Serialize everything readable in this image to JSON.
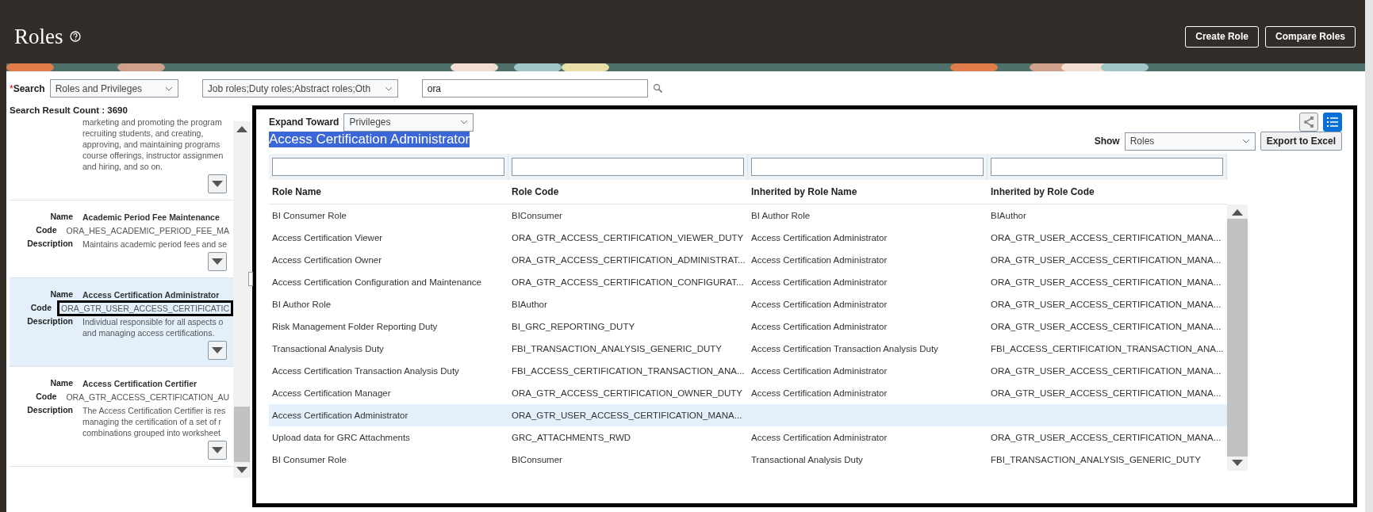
{
  "header": {
    "title": "Roles",
    "actions": [
      "Create Role",
      "Compare Roles"
    ]
  },
  "search": {
    "required_mark": "*",
    "label": "Search",
    "scope": "Roles and Privileges",
    "role_types": "Job roles;Duty roles;Abstract roles;Oth",
    "query": "ora"
  },
  "result_count": "Search Result Count : 3690",
  "results": [
    {
      "selected": false,
      "fields": [
        {
          "lines": [
            "marketing and promoting the program",
            "recruiting students, and creating,",
            "approving, and maintaining programs",
            "course offerings, instructor assignmen",
            "and hiring, and so on."
          ]
        }
      ]
    },
    {
      "selected": false,
      "fields": [
        {
          "label": "Name",
          "lines": [
            "Academic Period Fee Maintenance"
          ],
          "bold": true
        },
        {
          "label": "Code",
          "lines": [
            "ORA_HES_ACADEMIC_PERIOD_FEE_MA"
          ]
        },
        {
          "label": "Description",
          "lines": [
            "Maintains academic period fees and se"
          ]
        }
      ]
    },
    {
      "selected": true,
      "fields": [
        {
          "label": "Name",
          "lines": [
            "Access Certification Administrator"
          ],
          "bold": true
        },
        {
          "label": "Code",
          "lines": [
            "ORA_GTR_USER_ACCESS_CERTIFICATIC"
          ],
          "focused": true
        },
        {
          "label": "Description",
          "lines": [
            "Individual responsible for all aspects o",
            "and managing access certifications."
          ]
        }
      ]
    },
    {
      "selected": false,
      "fields": [
        {
          "label": "Name",
          "lines": [
            "Access Certification Certifier"
          ],
          "bold": true
        },
        {
          "label": "Code",
          "lines": [
            "ORA_GTR_ACCESS_CERTIFICATION_AU"
          ]
        },
        {
          "label": "Description",
          "lines": [
            "The Access Certification Certifier is res",
            "managing the certification of a set of r",
            "combinations grouped into worksheet"
          ]
        }
      ]
    }
  ],
  "detail": {
    "expand_label": "Expand Toward",
    "expand_value": "Privileges",
    "heading": "Access Certification Administrator",
    "views": [
      {
        "kind": "graph",
        "selected": false
      },
      {
        "kind": "list",
        "selected": true
      }
    ],
    "show_label": "Show",
    "show_value": "Roles",
    "export": "Export to Excel",
    "table": {
      "columns": [
        "Role Name",
        "Role Code",
        "Inherited by Role Name",
        "Inherited by Role Code"
      ],
      "rows": [
        {
          "selected": false,
          "cells": [
            "BI Consumer Role",
            "BIConsumer",
            "BI Author Role",
            "BIAuthor"
          ]
        },
        {
          "selected": false,
          "cells": [
            "Access Certification Viewer",
            "ORA_GTR_ACCESS_CERTIFICATION_VIEWER_DUTY",
            "Access Certification Administrator",
            "ORA_GTR_USER_ACCESS_CERTIFICATION_MANA..."
          ]
        },
        {
          "selected": false,
          "cells": [
            "Access Certification Owner",
            "ORA_GTR_ACCESS_CERTIFICATION_ADMINISTRAT...",
            "Access Certification Administrator",
            "ORA_GTR_USER_ACCESS_CERTIFICATION_MANA..."
          ]
        },
        {
          "selected": false,
          "cells": [
            "Access Certification Configuration and Maintenance",
            "ORA_GTR_ACCESS_CERTIFICATION_CONFIGURAT...",
            "Access Certification Administrator",
            "ORA_GTR_USER_ACCESS_CERTIFICATION_MANA..."
          ]
        },
        {
          "selected": false,
          "cells": [
            "BI Author Role",
            "BIAuthor",
            "Access Certification Administrator",
            "ORA_GTR_USER_ACCESS_CERTIFICATION_MANA..."
          ]
        },
        {
          "selected": false,
          "cells": [
            "Risk Management Folder Reporting Duty",
            "BI_GRC_REPORTING_DUTY",
            "Access Certification Administrator",
            "ORA_GTR_USER_ACCESS_CERTIFICATION_MANA..."
          ]
        },
        {
          "selected": false,
          "cells": [
            "Transactional Analysis Duty",
            "FBI_TRANSACTION_ANALYSIS_GENERIC_DUTY",
            "Access Certification Transaction Analysis Duty",
            "FBI_ACCESS_CERTIFICATION_TRANSACTION_ANA..."
          ]
        },
        {
          "selected": false,
          "cells": [
            "Access Certification Transaction Analysis Duty",
            "FBI_ACCESS_CERTIFICATION_TRANSACTION_ANA...",
            "Access Certification Administrator",
            "ORA_GTR_USER_ACCESS_CERTIFICATION_MANA..."
          ]
        },
        {
          "selected": false,
          "cells": [
            "Access Certification Manager",
            "ORA_GTR_ACCESS_CERTIFICATION_OWNER_DUTY",
            "Access Certification Administrator",
            "ORA_GTR_USER_ACCESS_CERTIFICATION_MANA..."
          ]
        },
        {
          "selected": true,
          "cells": [
            "Access Certification Administrator",
            "ORA_GTR_USER_ACCESS_CERTIFICATION_MANA..."
          ]
        },
        {
          "selected": false,
          "cells": [
            "Upload data for GRC Attachments",
            "GRC_ATTACHMENTS_RWD",
            "Access Certification Administrator",
            "ORA_GTR_USER_ACCESS_CERTIFICATION_MANA..."
          ]
        },
        {
          "selected": false,
          "cells": [
            "BI Consumer Role",
            "BIConsumer",
            "Transactional Analysis Duty",
            "FBI_TRANSACTION_ANALYSIS_GENERIC_DUTY"
          ]
        }
      ]
    }
  }
}
